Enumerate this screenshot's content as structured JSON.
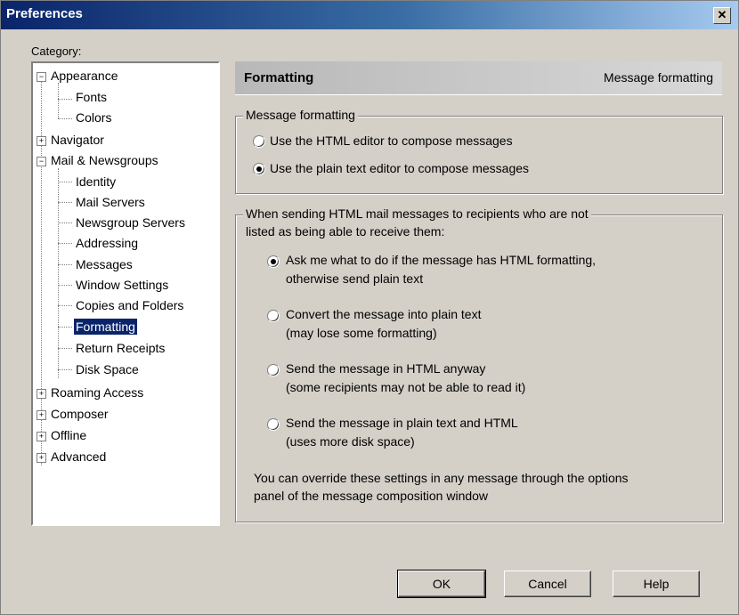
{
  "window": {
    "title": "Preferences",
    "close_glyph": "✕"
  },
  "category_label": "Category:",
  "tree": {
    "items": [
      {
        "label": "Appearance",
        "expander": "−"
      },
      {
        "label": "Fonts"
      },
      {
        "label": "Colors"
      },
      {
        "label": "Navigator",
        "expander": "+"
      },
      {
        "label": "Mail & Newsgroups",
        "expander": "−"
      },
      {
        "label": "Identity"
      },
      {
        "label": "Mail Servers"
      },
      {
        "label": "Newsgroup Servers"
      },
      {
        "label": "Addressing"
      },
      {
        "label": "Messages"
      },
      {
        "label": "Window Settings"
      },
      {
        "label": "Copies and Folders"
      },
      {
        "label": "Formatting",
        "selected": true
      },
      {
        "label": "Return Receipts"
      },
      {
        "label": "Disk Space"
      },
      {
        "label": "Roaming Access",
        "expander": "+"
      },
      {
        "label": "Composer",
        "expander": "+"
      },
      {
        "label": "Offline",
        "expander": "+"
      },
      {
        "label": "Advanced",
        "expander": "+"
      }
    ]
  },
  "panel": {
    "title": "Formatting",
    "subtitle": "Message formatting",
    "group1": {
      "legend": "Message formatting",
      "options": [
        {
          "label": "Use the HTML editor to compose messages",
          "checked": false
        },
        {
          "label": "Use the plain text editor to compose messages",
          "checked": true
        }
      ]
    },
    "group2": {
      "legend_line1": "When sending HTML mail messages to recipients who are not",
      "legend_line2": "listed as being able to receive them:",
      "options": [
        {
          "line1": "Ask me what to do if the message has HTML formatting,",
          "line2": "otherwise send plain text",
          "checked": true
        },
        {
          "line1": "Convert the message into plain text",
          "line2": "(may lose some formatting)",
          "checked": false
        },
        {
          "line1": "Send the message in HTML anyway",
          "line2": "(some recipients may not be able to read it)",
          "checked": false
        },
        {
          "line1": "Send the message in plain text and HTML",
          "line2": "(uses more disk space)",
          "checked": false
        }
      ],
      "note_line1": "You can override these settings in any message through the options",
      "note_line2": "panel of the message composition window"
    }
  },
  "buttons": {
    "ok": "OK",
    "cancel": "Cancel",
    "help": "Help"
  }
}
